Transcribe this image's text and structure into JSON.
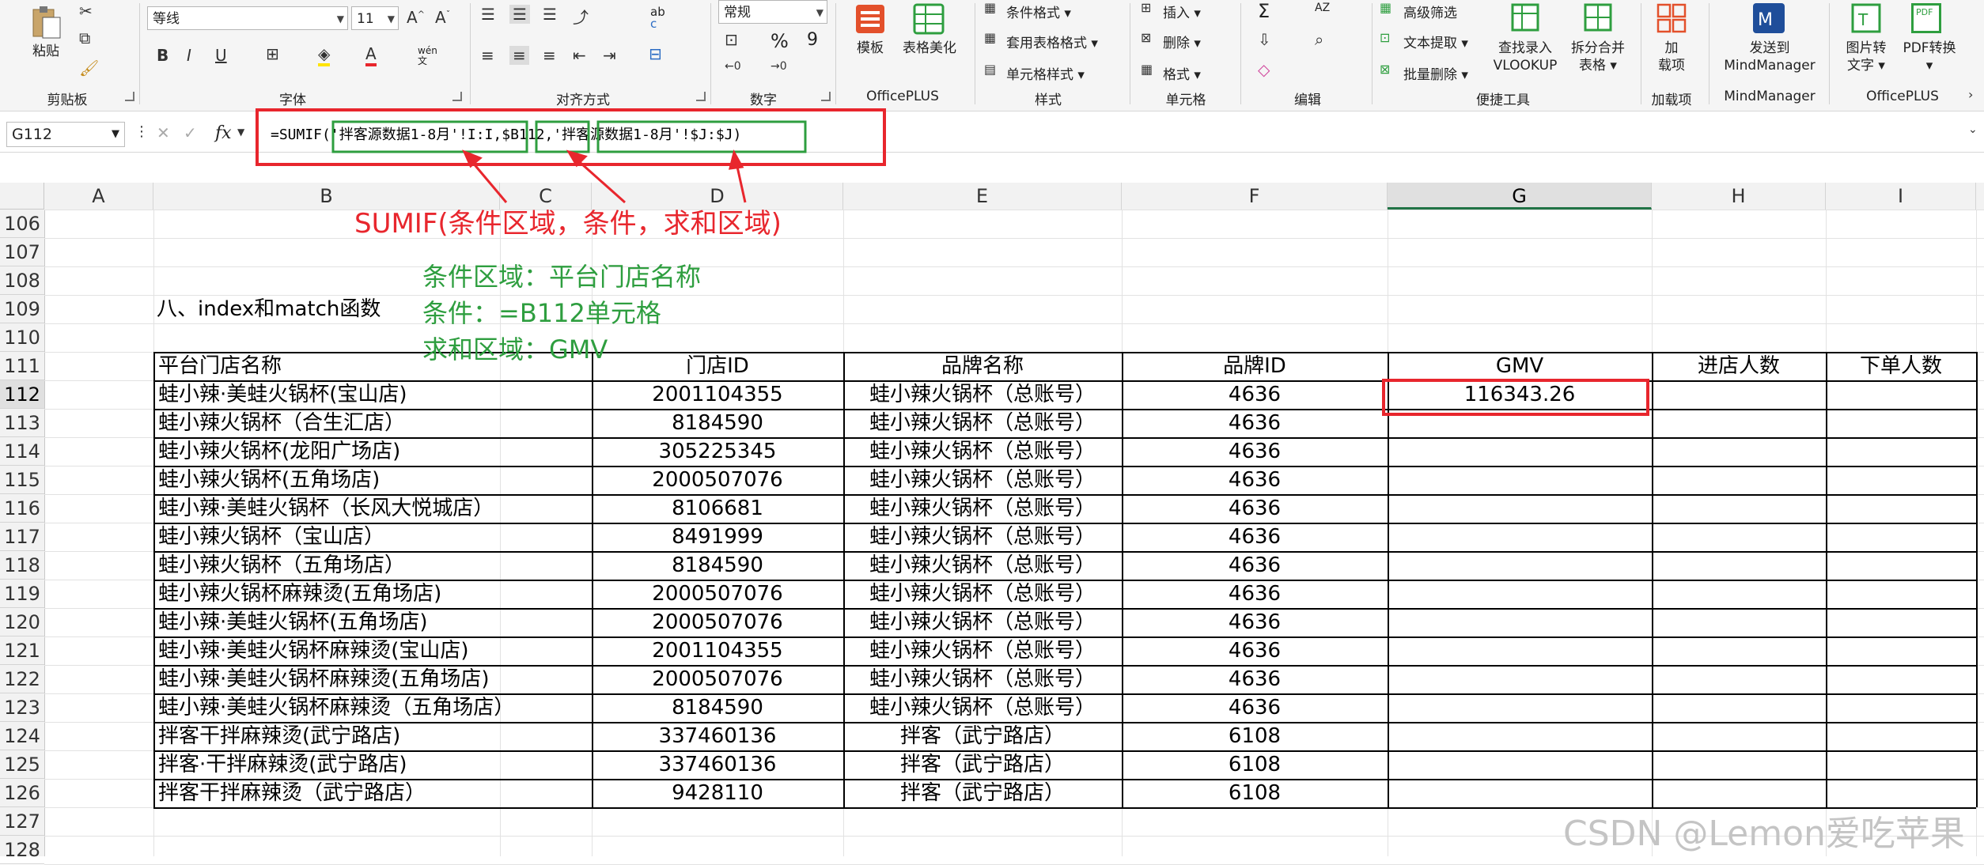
{
  "ribbon": {
    "clipboard": {
      "paste": "粘贴",
      "group": "剪贴板"
    },
    "font": {
      "name": "等线",
      "size": "11",
      "group": "字体",
      "wen": "wén",
      "wen2": "文"
    },
    "alignment": {
      "group": "对齐方式",
      "wrap_icon": "ab",
      "wrap_icon2": "c"
    },
    "number": {
      "format": "常规",
      "percent": "%",
      "comma": "9",
      "group": "数字"
    },
    "officeplus1": {
      "template": "模板",
      "beautify": "表格美化",
      "group": "OfficePLUS"
    },
    "styles": {
      "conditional": "条件格式",
      "table_format": "套用表格格式",
      "cell_style": "单元格样式",
      "group": "样式"
    },
    "cells": {
      "insert": "插入",
      "delete": "删除",
      "format": "格式",
      "group": "单元格"
    },
    "editing": {
      "sum": "Σ",
      "sort": "AZ",
      "group": "编辑"
    },
    "tools": {
      "advanced_filter": "高级筛选",
      "text_extract": "文本提取",
      "batch_delete": "批量删除",
      "vlookup": "查找录入VLOOKUP",
      "vlookup_l1": "查找录入",
      "vlookup_l2": "VLOOKUP",
      "split_l1": "拆分合并",
      "split_l2": "表格",
      "group": "便捷工具"
    },
    "addins": {
      "l1": "加",
      "l2": "载项",
      "group": "加载项"
    },
    "mindmanager": {
      "l1": "发送到",
      "l2": "MindManager",
      "group": "MindManager"
    },
    "officeplus2": {
      "img_l1": "图片转",
      "img_l2": "文字",
      "pdf": "PDF转换",
      "pdf_icon": "PDF",
      "group": "OfficePLUS"
    }
  },
  "formula_bar": {
    "name_box": "G112",
    "fx": "fx",
    "formula": "=SUMIF('拌客源数据1-8月'!I:I,$B112,'拌客源数据1-8月'!$J:$J)",
    "f_prefix": "=SUMIF(",
    "f_arg1": "'拌客源数据1-8月'!I:I",
    "f_arg2": "$B112",
    "f_arg3": "'拌客源数据1-8月'!$J:$J",
    "f_suffix": ")"
  },
  "columns": [
    "A",
    "B",
    "C",
    "D",
    "E",
    "F",
    "G",
    "H",
    "I"
  ],
  "rows": [
    "106",
    "107",
    "108",
    "109",
    "110",
    "111",
    "112",
    "113",
    "114",
    "115",
    "116",
    "117",
    "118",
    "119",
    "120",
    "121",
    "122",
    "123",
    "124",
    "125",
    "126",
    "127",
    "128"
  ],
  "section_title": "八、index和match函数",
  "table": {
    "headers": [
      "平台门店名称",
      "门店ID",
      "品牌名称",
      "品牌ID",
      "GMV",
      "进店人数",
      "下单人数"
    ],
    "rows": [
      [
        "蛙小辣·美蛙火锅杯(宝山店)",
        "2001104355",
        "蛙小辣火锅杯（总账号）",
        "4636",
        "116343.26",
        "",
        ""
      ],
      [
        "蛙小辣火锅杯（合生汇店）",
        "8184590",
        "蛙小辣火锅杯（总账号）",
        "4636",
        "",
        "",
        ""
      ],
      [
        "蛙小辣火锅杯(龙阳广场店)",
        "305225345",
        "蛙小辣火锅杯（总账号）",
        "4636",
        "",
        "",
        ""
      ],
      [
        "蛙小辣火锅杯(五角场店)",
        "2000507076",
        "蛙小辣火锅杯（总账号）",
        "4636",
        "",
        "",
        ""
      ],
      [
        "蛙小辣·美蛙火锅杯（长风大悦城店）",
        "8106681",
        "蛙小辣火锅杯（总账号）",
        "4636",
        "",
        "",
        ""
      ],
      [
        "蛙小辣火锅杯（宝山店）",
        "8491999",
        "蛙小辣火锅杯（总账号）",
        "4636",
        "",
        "",
        ""
      ],
      [
        "蛙小辣火锅杯（五角场店）",
        "8184590",
        "蛙小辣火锅杯（总账号）",
        "4636",
        "",
        "",
        ""
      ],
      [
        "蛙小辣火锅杯麻辣烫(五角场店)",
        "2000507076",
        "蛙小辣火锅杯（总账号）",
        "4636",
        "",
        "",
        ""
      ],
      [
        "蛙小辣·美蛙火锅杯(五角场店)",
        "2000507076",
        "蛙小辣火锅杯（总账号）",
        "4636",
        "",
        "",
        ""
      ],
      [
        "蛙小辣·美蛙火锅杯麻辣烫(宝山店)",
        "2001104355",
        "蛙小辣火锅杯（总账号）",
        "4636",
        "",
        "",
        ""
      ],
      [
        "蛙小辣·美蛙火锅杯麻辣烫(五角场店)",
        "2000507076",
        "蛙小辣火锅杯（总账号）",
        "4636",
        "",
        "",
        ""
      ],
      [
        "蛙小辣·美蛙火锅杯麻辣烫（五角场店）",
        "8184590",
        "蛙小辣火锅杯（总账号）",
        "4636",
        "",
        "",
        ""
      ],
      [
        "拌客干拌麻辣烫(武宁路店)",
        "337460136",
        "拌客（武宁路店）",
        "6108",
        "",
        "",
        ""
      ],
      [
        "拌客·干拌麻辣烫(武宁路店)",
        "337460136",
        "拌客（武宁路店）",
        "6108",
        "",
        "",
        ""
      ],
      [
        "拌客干拌麻辣烫（武宁路店）",
        "9428110",
        "拌客（武宁路店）",
        "6108",
        "",
        "",
        ""
      ]
    ]
  },
  "annotations": {
    "red_label": "SUMIF(条件区域，条件，求和区域)",
    "green_lines": [
      "条件区域：平台门店名称",
      "条件：=B112单元格",
      "求和区域：GMV"
    ]
  },
  "watermark": "CSDN @Lemon爱吃苹果",
  "colors": {
    "red": "#e8262d",
    "green": "#2e9e3f",
    "excel_green": "#217346"
  }
}
